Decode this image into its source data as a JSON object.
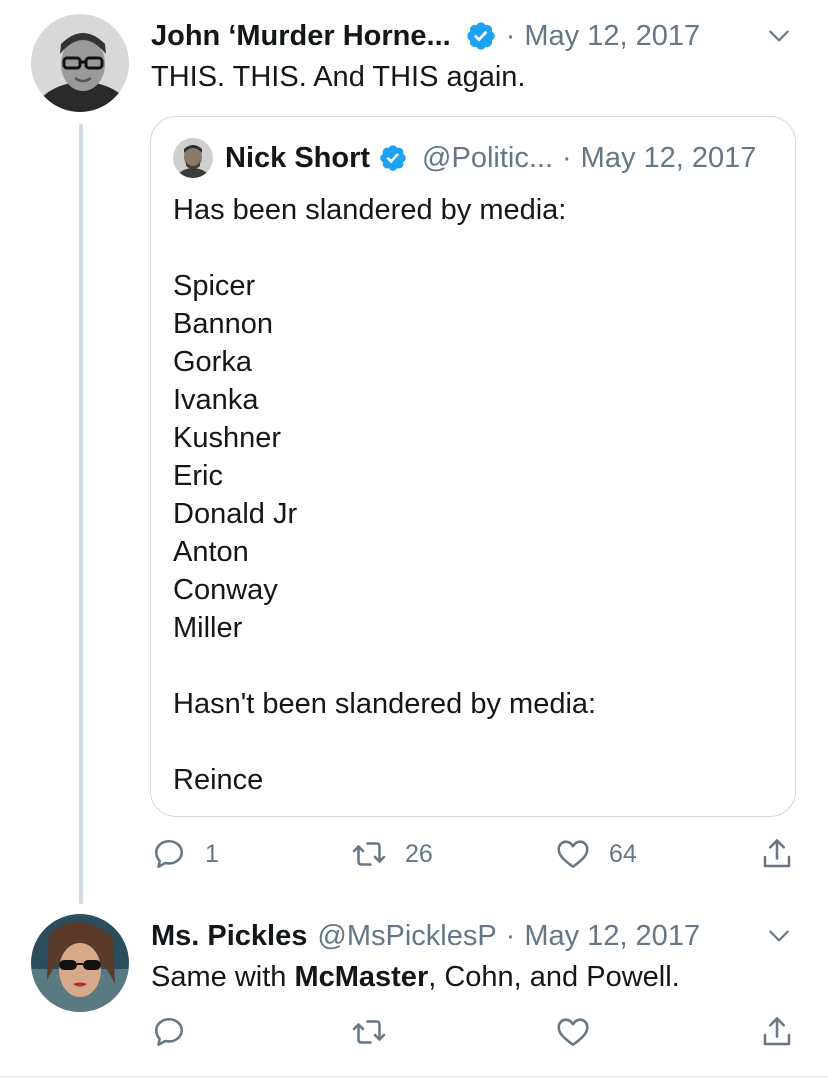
{
  "tweets": [
    {
      "author": "John ‘Murder Horne...",
      "date": "May 12, 2017",
      "text": "THIS. THIS. And THIS again.",
      "quote": {
        "author": "Nick Short",
        "handle": "@Politic...",
        "date": "May 12, 2017",
        "lines": [
          "Has been slandered by media:",
          "",
          "Spicer",
          "Bannon",
          "Gorka",
          "Ivanka",
          "Kushner",
          "Eric",
          "Donald Jr",
          "Anton",
          "Conway",
          "Miller",
          "",
          "Hasn't been slandered by media:",
          "",
          "Reince"
        ]
      },
      "stats": {
        "replies": "1",
        "retweets": "26",
        "likes": "64"
      }
    },
    {
      "author": "Ms. Pickles",
      "handle": "@MsPicklesP",
      "date": "May 12, 2017",
      "text_parts": [
        "Same with ",
        "McMaster",
        ", Cohn, and Powell."
      ]
    }
  ],
  "colors": {
    "verified": "#1da1f2",
    "muted": "#657786",
    "border": "#cfd9de"
  },
  "icons": [
    "verified-badge-icon",
    "chevron-down-icon",
    "reply-icon",
    "retweet-icon",
    "like-icon",
    "share-icon"
  ]
}
